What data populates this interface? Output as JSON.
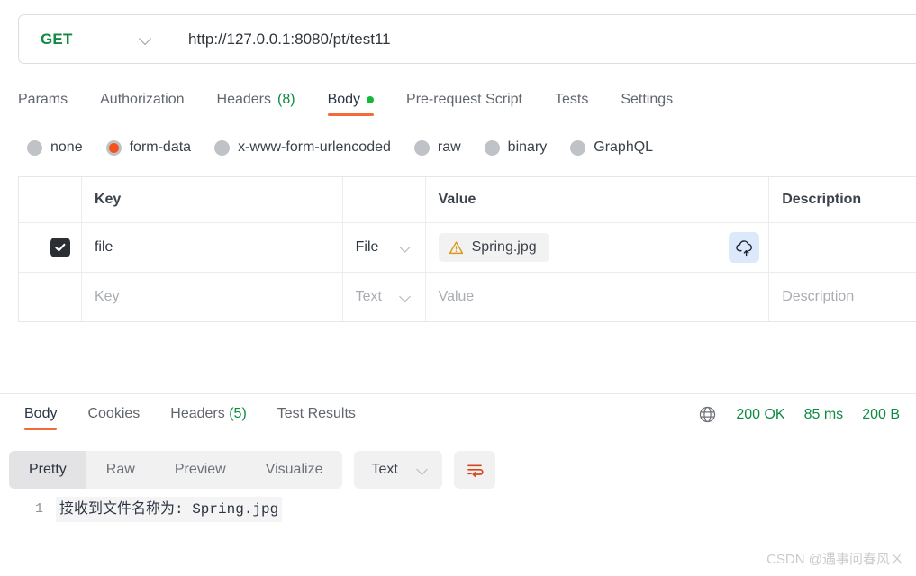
{
  "request": {
    "method": "GET",
    "url": "http://127.0.0.1:8080/pt/test11",
    "tabs": [
      {
        "label": "Params",
        "count": "",
        "active": false,
        "dot": false
      },
      {
        "label": "Authorization",
        "count": "",
        "active": false,
        "dot": false
      },
      {
        "label": "Headers",
        "count": "(8)",
        "active": false,
        "dot": false
      },
      {
        "label": "Body",
        "count": "",
        "active": true,
        "dot": true
      },
      {
        "label": "Pre-request Script",
        "count": "",
        "active": false,
        "dot": false
      },
      {
        "label": "Tests",
        "count": "",
        "active": false,
        "dot": false
      },
      {
        "label": "Settings",
        "count": "",
        "active": false,
        "dot": false
      }
    ],
    "body_types": [
      {
        "label": "none",
        "selected": false
      },
      {
        "label": "form-data",
        "selected": true
      },
      {
        "label": "x-www-form-urlencoded",
        "selected": false
      },
      {
        "label": "raw",
        "selected": false
      },
      {
        "label": "binary",
        "selected": false
      },
      {
        "label": "GraphQL",
        "selected": false
      }
    ],
    "table": {
      "headers": {
        "key": "Key",
        "value": "Value",
        "description": "Description"
      },
      "rows": [
        {
          "checked": true,
          "key": "file",
          "type": "File",
          "value": "Spring.jpg",
          "description": "",
          "is_file": true,
          "upload_icon": "cloud-upload-icon",
          "warning_icon": "warning-triangle-icon"
        },
        {
          "checked": false,
          "key": "Key",
          "type": "Text",
          "value": "Value",
          "description": "Description",
          "is_file": false,
          "placeholder_row": true
        }
      ]
    }
  },
  "response": {
    "tabs": [
      {
        "label": "Body",
        "count": "",
        "active": true
      },
      {
        "label": "Cookies",
        "count": "",
        "active": false
      },
      {
        "label": "Headers",
        "count": "(5)",
        "active": false
      },
      {
        "label": "Test Results",
        "count": "",
        "active": false
      }
    ],
    "status": {
      "globe_icon": "globe-icon",
      "code": "200 OK",
      "time": "85 ms",
      "size": "200 B"
    },
    "view_modes": [
      {
        "label": "Pretty",
        "active": true
      },
      {
        "label": "Raw",
        "active": false
      },
      {
        "label": "Preview",
        "active": false
      },
      {
        "label": "Visualize",
        "active": false
      }
    ],
    "format": "Text",
    "wrap_icon": "word-wrap-icon",
    "body": {
      "lines": [
        {
          "number": "1",
          "text": "接收到文件名称为: Spring.jpg"
        }
      ]
    }
  },
  "watermark": "CSDN @遇事问春风ㄨ",
  "colors": {
    "accent": "#f26b3a",
    "method": "#0f8a43",
    "success": "#0f8a43",
    "radio_selected": "#f4521d",
    "upload_bg": "#dce9fb",
    "warning": "#d79a1e"
  }
}
